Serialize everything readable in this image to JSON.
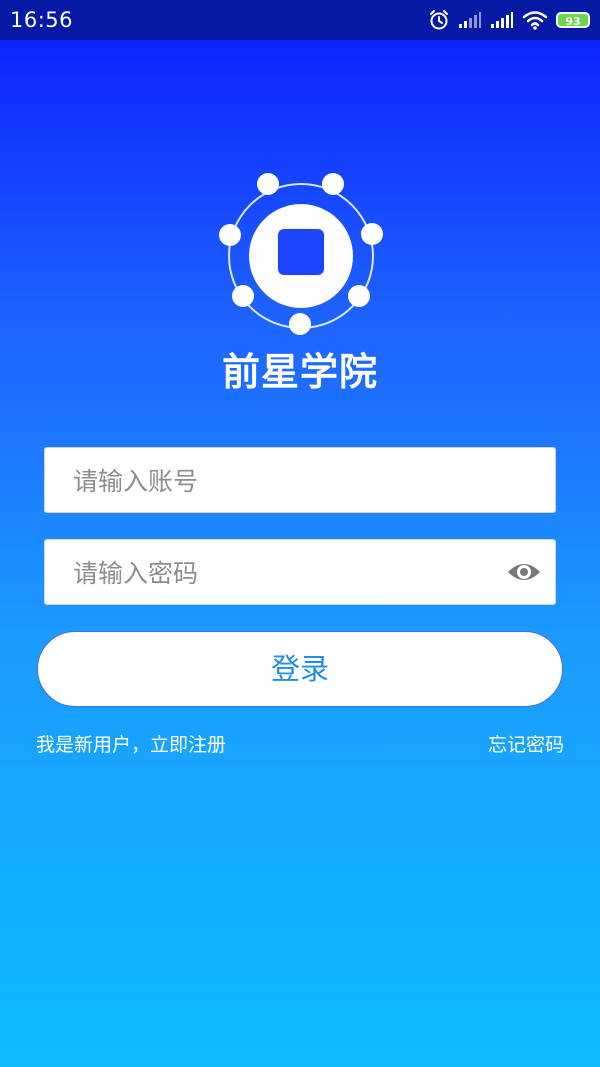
{
  "status_bar": {
    "time": "16:56",
    "battery": "93",
    "icons": [
      "alarm-icon",
      "signal-icon",
      "signal-icon",
      "wifi-icon",
      "battery-icon"
    ]
  },
  "app": {
    "title": "前星学院"
  },
  "form": {
    "account_placeholder": "请输入账号",
    "account_value": "",
    "password_placeholder": "请输入密码",
    "password_value": "",
    "login_label": "登录"
  },
  "links": {
    "register": "我是新用户，立即注册",
    "forgot": "忘记密码"
  },
  "colors": {
    "status_bar": "#061aa6",
    "gradient_top": "#0a1cff",
    "gradient_bottom": "#0dbcff",
    "button_text": "#1e8fe6",
    "battery": "#69d84f"
  }
}
